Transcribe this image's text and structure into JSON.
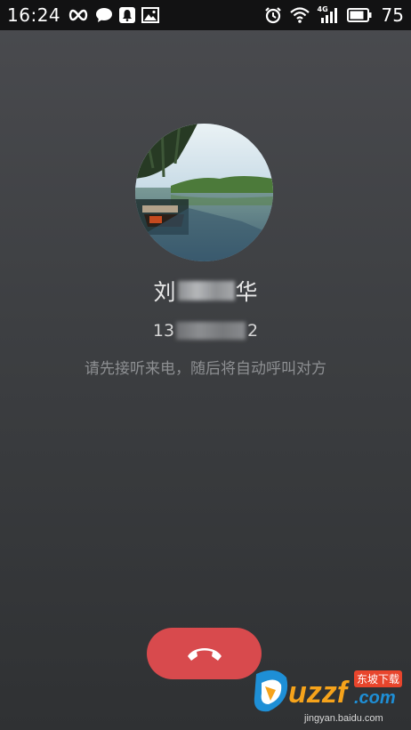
{
  "status_bar": {
    "time": "16:24",
    "left_icons": [
      "infinity-icon",
      "chat-bubble-icon",
      "notification-icon",
      "image-icon"
    ],
    "right_icons": [
      "alarm-icon",
      "wifi-icon",
      "signal-4g-icon",
      "battery-icon"
    ],
    "network_label": "4G",
    "battery": "75"
  },
  "caller": {
    "name_first": "刘",
    "name_last": "华",
    "number_prefix": "13",
    "number_suffix": "2"
  },
  "hint": "请先接听来电，随后将自动呼叫对方",
  "hangup_icon": "phone-hangup-icon",
  "colors": {
    "hangup_button": "#d84a4d",
    "status_bar": "#121213",
    "background_top": "#4a4b4f",
    "background_bottom": "#2f3133"
  },
  "watermark": {
    "logo_text": "uzzf",
    "logo_suffix": ".com",
    "badge": "东坡下载",
    "url": "jingyan.baidu.com"
  }
}
